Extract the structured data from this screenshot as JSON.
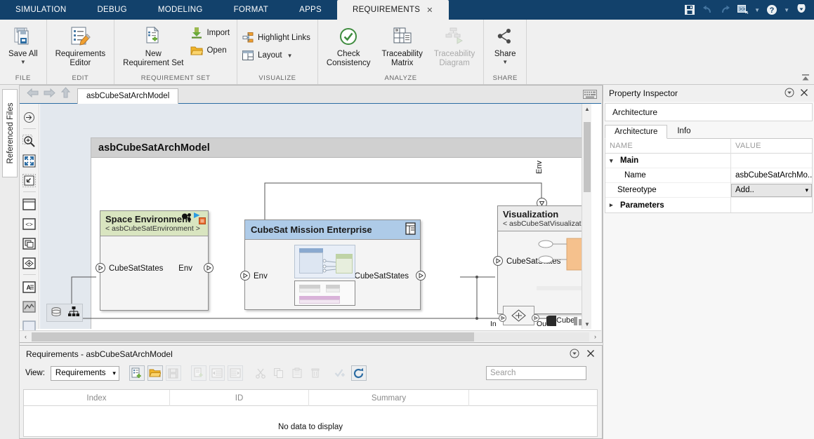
{
  "ribbon": {
    "tabs": [
      {
        "label": "SIMULATION",
        "active": false
      },
      {
        "label": "DEBUG",
        "active": false
      },
      {
        "label": "MODELING",
        "active": false
      },
      {
        "label": "FORMAT",
        "active": false
      },
      {
        "label": "APPS",
        "active": false
      },
      {
        "label": "REQUIREMENTS",
        "active": true
      }
    ],
    "close_tab_glyph": "✕",
    "quick_access": [
      {
        "name": "save-icon"
      },
      {
        "name": "undo-icon"
      },
      {
        "name": "redo-icon"
      },
      {
        "name": "run-to-cursor-icon"
      },
      {
        "name": "help-icon"
      },
      {
        "name": "search-dropdown-icon"
      }
    ],
    "groups": [
      {
        "label": "FILE",
        "buttons": [
          {
            "label": "Save All",
            "icon": "save-all-icon",
            "caret": true,
            "disabled": false
          }
        ]
      },
      {
        "label": "EDIT",
        "buttons": [
          {
            "label": "Requirements\nEditor",
            "icon": "requirements-editor-icon",
            "caret": false,
            "disabled": false
          }
        ]
      },
      {
        "label": "REQUIREMENT SET",
        "buttons": [
          {
            "label": "New\nRequirement Set",
            "icon": "new-requirement-set-icon",
            "caret": false,
            "disabled": false
          }
        ],
        "small_buttons": [
          {
            "label": "Import",
            "icon": "import-icon",
            "caret": false
          },
          {
            "label": "Open",
            "icon": "open-folder-icon",
            "caret": false
          }
        ]
      },
      {
        "label": "VISUALIZE",
        "small_buttons": [
          {
            "label": "Highlight Links",
            "icon": "highlight-links-icon",
            "caret": false
          },
          {
            "label": "Layout",
            "icon": "layout-icon",
            "caret": true
          }
        ]
      },
      {
        "label": "ANALYZE",
        "buttons": [
          {
            "label": "Check\nConsistency",
            "icon": "check-consistency-icon",
            "caret": false,
            "disabled": false
          },
          {
            "label": "Traceability\nMatrix",
            "icon": "traceability-matrix-icon",
            "caret": false,
            "disabled": false
          },
          {
            "label": "Traceability\nDiagram",
            "icon": "traceability-diagram-icon",
            "caret": false,
            "disabled": true
          }
        ]
      },
      {
        "label": "SHARE",
        "buttons": [
          {
            "label": "Share",
            "icon": "share-icon",
            "caret": true,
            "disabled": false
          }
        ]
      }
    ]
  },
  "left_dock": {
    "tab_label": "Referenced Files"
  },
  "editor": {
    "model_tab": "asbCubeSatArchModel",
    "nav": [
      {
        "name": "back-arrow-icon"
      },
      {
        "name": "forward-arrow-icon"
      },
      {
        "name": "up-arrow-icon"
      }
    ],
    "keyboard_icon": "keyboard-icon",
    "canvas_tools": [
      {
        "name": "navigate-icon"
      },
      {
        "name": "zoom-in-icon"
      },
      {
        "name": "fit-to-view-icon"
      },
      {
        "name": "zoom-to-selection-icon"
      },
      {
        "name": "component-icon"
      },
      {
        "name": "reference-component-icon"
      },
      {
        "name": "variant-component-icon"
      },
      {
        "name": "adapter-icon"
      },
      {
        "name": "annotation-icon"
      },
      {
        "name": "simulink-subsystem-icon"
      },
      {
        "name": "blank-block-icon"
      }
    ],
    "corner_tools": [
      {
        "name": "data-layers-icon"
      },
      {
        "name": "hierarchy-icon"
      }
    ],
    "diagram": {
      "title": "asbCubeSatArchModel",
      "blocks": [
        {
          "name": "Space Environment",
          "stereotype": "< asbCubeSatEnvironment >",
          "header_color": "#d9e5c0",
          "inports": [
            "CubeSatStates"
          ],
          "outports": [
            "Env"
          ],
          "badges": [
            "variant-badge-icon",
            "simulink-badge-icon",
            "stereotype-badge-icon"
          ]
        },
        {
          "name": "CubeSat Mission Enterprise",
          "stereotype": "",
          "header_color": "#aecbe8",
          "inports": [
            "Env"
          ],
          "outports": [
            "CubeSatStates"
          ],
          "badges": [
            "reference-badge-icon"
          ]
        },
        {
          "name": "Visualization",
          "stereotype": "< asbCubeSatVisualization >",
          "header_color": "#ececec",
          "inports": [
            "CubeSatStates"
          ],
          "outports": [],
          "badges": [
            "simulink-badge-icon",
            "stereotype-badge-icon"
          ]
        }
      ],
      "signal_labels": [
        "Env"
      ],
      "adapter": {
        "in_label": "In",
        "out_label": "Out",
        "trailing_label": "Cube"
      }
    },
    "scroll": {
      "up_glyph": "▲",
      "down_glyph": "▼",
      "left_glyph": "‹",
      "right_glyph": "›"
    }
  },
  "property_inspector": {
    "title": "Property Inspector",
    "collapse_icon": "collapse-panel-icon",
    "close_icon": "close-icon",
    "subject": "Architecture",
    "tabs": [
      {
        "label": "Architecture",
        "active": true
      },
      {
        "label": "Info",
        "active": false
      }
    ],
    "columns": [
      "NAME",
      "VALUE"
    ],
    "rows": [
      {
        "type": "group",
        "expanded": true,
        "name": "Main",
        "value": ""
      },
      {
        "type": "field",
        "name": "Name",
        "value": "asbCubeSatArchMo...",
        "indent": true
      },
      {
        "type": "field",
        "name": "Stereotype",
        "value": "Add..",
        "control": "dropdown"
      },
      {
        "type": "group",
        "expanded": false,
        "name": "Parameters",
        "value": ""
      }
    ],
    "dropdown_caret": "▾"
  },
  "requirements_panel": {
    "title": "Requirements - asbCubeSatArchModel",
    "collapse_icon": "collapse-panel-icon",
    "close_icon": "close-icon",
    "view_label": "View:",
    "view_value": "Requirements",
    "view_caret": "▾",
    "toolbar_buttons": [
      {
        "name": "new-requirement-set-button",
        "disabled": false,
        "boxed": true
      },
      {
        "name": "open-requirement-set-button",
        "disabled": false,
        "boxed": true
      },
      {
        "name": "save-requirement-set-button",
        "disabled": true,
        "boxed": true
      },
      {
        "name": "add-requirement-button",
        "disabled": true,
        "boxed": true
      },
      {
        "name": "promote-requirement-button",
        "disabled": true,
        "boxed": true
      },
      {
        "name": "demote-requirement-button",
        "disabled": true,
        "boxed": true
      },
      {
        "name": "cut-button",
        "disabled": true,
        "boxed": false
      },
      {
        "name": "copy-button",
        "disabled": true,
        "boxed": false
      },
      {
        "name": "paste-button",
        "disabled": true,
        "boxed": false
      },
      {
        "name": "delete-button",
        "disabled": true,
        "boxed": false
      },
      {
        "name": "check-consistency-button",
        "disabled": true,
        "boxed": false
      },
      {
        "name": "refresh-button",
        "disabled": false,
        "boxed": true
      }
    ],
    "search_placeholder": "Search",
    "columns": [
      "Index",
      "ID",
      "Summary",
      ""
    ],
    "empty_message": "No data to display"
  },
  "colors": {
    "ribbon_tabbar": "#12416b",
    "ribbon_bg": "#f0f0f0",
    "accent_blue": "#2b6ca3",
    "env_block_header": "#d9e5c0",
    "mission_block_header": "#aecbe8",
    "visualization_fill": "#f5c18d",
    "canvas_bg": "#e3e8ee"
  }
}
